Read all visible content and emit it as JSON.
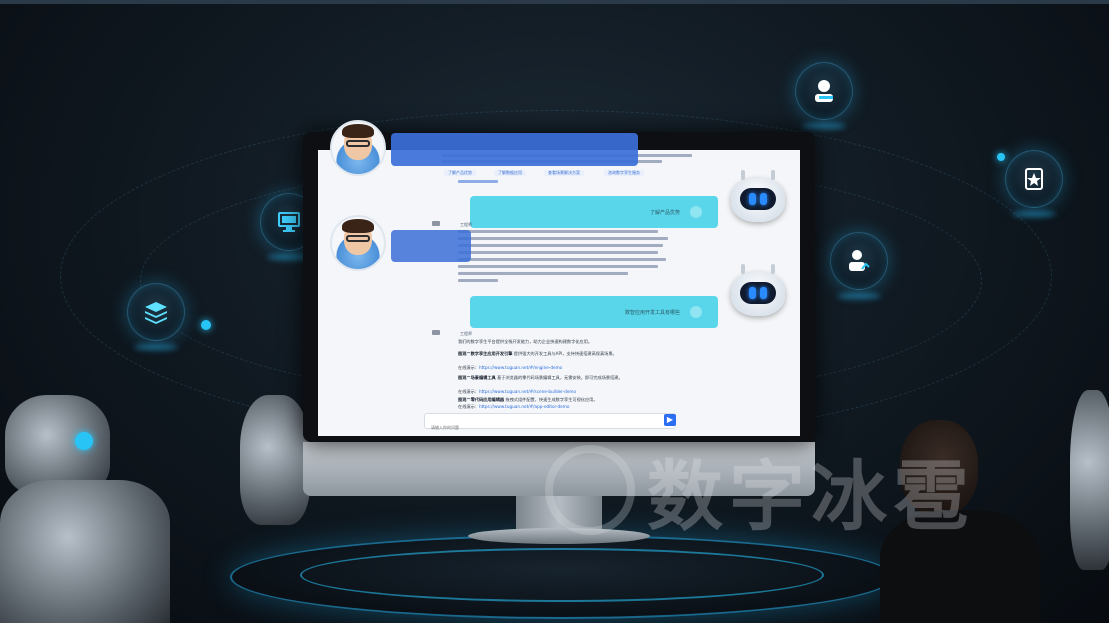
{
  "watermark": {
    "text": "数字冰雹"
  },
  "hub_icons": [
    "user-icon",
    "star-document-icon",
    "user-chart-icon",
    "monitor-icon",
    "layers-icon"
  ],
  "chat": {
    "suggestions": [
      "了解产品优势",
      "了解数据应用",
      "查看场景解决方案",
      "咨询数字孪生服务"
    ],
    "user_question_1": "了解产品优势",
    "user_question_2": "数智应用开发工具有哪些",
    "reply_tag": "工程师",
    "reply_intro": "我们的数字孪生平台提供全栈开发能力，助力企业快速构建数字化应用。",
    "tools": [
      {
        "name": "图观™数字孪生应用开发引擎",
        "desc": "提供强大的开发工具与API，支持快速搭建高保真场景。",
        "link_label": "在线演示：",
        "link": "https://www.tuguan.net/#/engine-demo"
      },
      {
        "name": "图观™场景编辑工具",
        "desc": "基于浏览器的零代码场景编辑工具，无需安装，即可完成场景搭建。",
        "link_label": "在线演示：",
        "link": "https://www.tuguan.net/#/scene-builder-demo"
      },
      {
        "name": "图观™零代码应用编辑器",
        "desc": "拖拽式组件配置，快速生成数字孪生可视化应用。",
        "link_label": "在线演示：",
        "link": "https://www.tuguan.net/#/app-editor-demo"
      }
    ],
    "input_placeholder": "请输入你的问题",
    "send_icon": "▶"
  },
  "colors": {
    "accent": "#27c4f5",
    "user_bubble": "#3b6fd8",
    "bot_bubble": "#5ad6ea",
    "send": "#2c6ef2"
  }
}
